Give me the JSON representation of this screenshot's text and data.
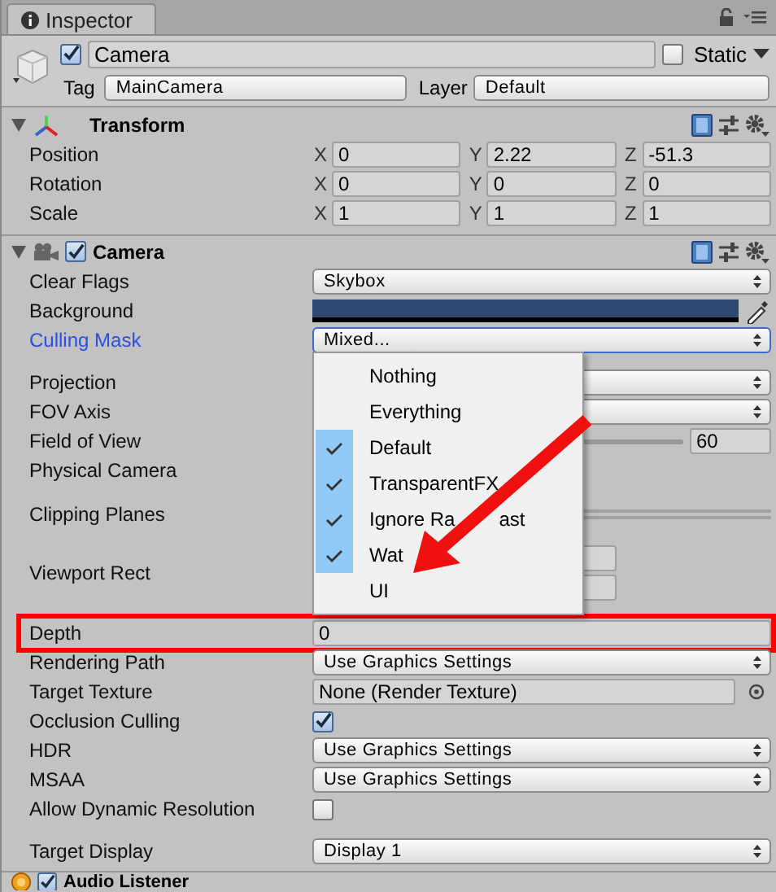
{
  "tab": {
    "title": "Inspector"
  },
  "object": {
    "active": true,
    "name": "Camera",
    "static": false,
    "static_label": "Static",
    "tag_label": "Tag",
    "tag": "MainCamera",
    "layer_label": "Layer",
    "layer": "Default"
  },
  "transform": {
    "title": "Transform",
    "expanded": true,
    "rows": [
      {
        "label": "Position",
        "fields": [
          {
            "axis": "X",
            "value": "0"
          },
          {
            "axis": "Y",
            "value": "2.22"
          },
          {
            "axis": "Z",
            "value": "-51.3"
          }
        ]
      },
      {
        "label": "Rotation",
        "fields": [
          {
            "axis": "X",
            "value": "0"
          },
          {
            "axis": "Y",
            "value": "0"
          },
          {
            "axis": "Z",
            "value": "0"
          }
        ]
      },
      {
        "label": "Scale",
        "fields": [
          {
            "axis": "X",
            "value": "1"
          },
          {
            "axis": "Y",
            "value": "1"
          },
          {
            "axis": "Z",
            "value": "1"
          }
        ]
      }
    ]
  },
  "camera": {
    "title": "Camera",
    "enabled": true,
    "expanded": true,
    "properties": [
      {
        "label": "Clear Flags",
        "kind": "dropdown",
        "value": "Skybox"
      },
      {
        "label": "Background",
        "kind": "color",
        "color": "#2e4a74"
      },
      {
        "label": "Culling Mask",
        "kind": "dropdown",
        "value": "Mixed...",
        "focused": true
      },
      {
        "label": "Projection",
        "kind": "dropdown",
        "gap_before": true
      },
      {
        "label": "FOV Axis",
        "kind": "dropdown"
      },
      {
        "label": "Field of View",
        "kind": "slider",
        "value": "60"
      },
      {
        "label": "Physical Camera",
        "kind": "blank"
      },
      {
        "label": "Clipping Planes",
        "kind": "pair"
      },
      {
        "label": "Viewport Rect",
        "kind": "rect"
      },
      {
        "label": "Depth",
        "kind": "number",
        "value": "0",
        "annotated": true,
        "gap_before": true
      },
      {
        "label": "Rendering Path",
        "kind": "dropdown",
        "value": "Use Graphics Settings"
      },
      {
        "label": "Target Texture",
        "kind": "object",
        "value": "None (Render Texture)"
      },
      {
        "label": "Occlusion Culling",
        "kind": "checkbox",
        "checked": true
      },
      {
        "label": "HDR",
        "kind": "dropdown",
        "value": "Use Graphics Settings"
      },
      {
        "label": "MSAA",
        "kind": "dropdown",
        "value": "Use Graphics Settings"
      },
      {
        "label": "Allow Dynamic Resolution",
        "kind": "checkbox",
        "checked": false
      },
      {
        "label": "Target Display",
        "kind": "dropdown",
        "value": "Display 1",
        "gap_before": true
      }
    ]
  },
  "menu": {
    "items": [
      {
        "label": "Nothing",
        "checked": false
      },
      {
        "label": "Everything",
        "checked": false
      },
      {
        "label": "Default",
        "checked": true
      },
      {
        "label": "TransparentFX",
        "checked": true
      },
      {
        "label": "Ignore Ra",
        "after_arrow": "ast",
        "checked": true
      },
      {
        "label": "Wat",
        "checked": true
      },
      {
        "label": "UI",
        "checked": false
      }
    ]
  },
  "next_component": {
    "title": "Audio Listener",
    "enabled": true
  }
}
